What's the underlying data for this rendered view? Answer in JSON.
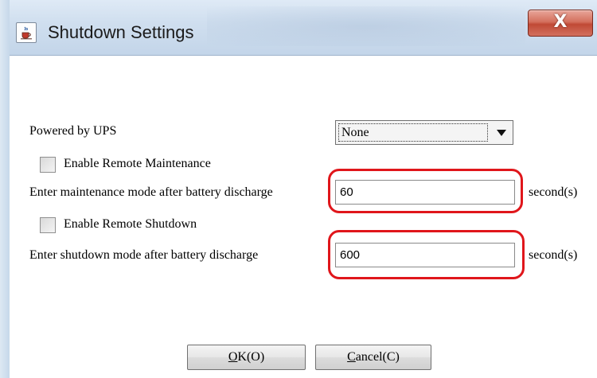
{
  "window": {
    "title": "Shutdown Settings",
    "close_label": "X"
  },
  "form": {
    "ups_label": "Powered by UPS",
    "ups_selected": "None",
    "enable_maintenance_label": "Enable Remote Maintenance",
    "maintenance_label": "Enter maintenance mode after battery discharge",
    "maintenance_value": "60",
    "maintenance_unit": "second(s)",
    "enable_shutdown_label": "Enable Remote Shutdown",
    "shutdown_label": "Enter shutdown mode after battery discharge",
    "shutdown_value": "600",
    "shutdown_unit": "second(s)"
  },
  "buttons": {
    "ok_mnemonic": "O",
    "ok_rest": "K(O)",
    "cancel_mnemonic": "C",
    "cancel_rest": "ancel(C)"
  },
  "colors": {
    "highlight": "#e0161b",
    "titlebar": "#d0dfef",
    "close_button": "#c04a36"
  },
  "icons": {
    "app": "java-cup-icon",
    "close": "close-icon",
    "dropdown": "chevron-down-icon"
  }
}
